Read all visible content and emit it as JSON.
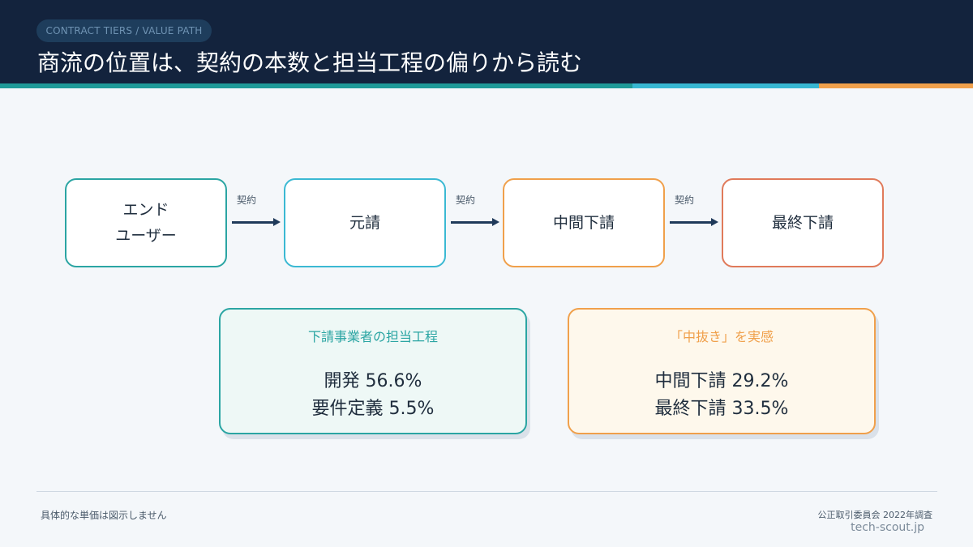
{
  "header": {
    "tag": "CONTRACT TIERS / VALUE PATH",
    "title": "商流の位置は、契約の本数と担当工程の偏りから読む"
  },
  "flow": {
    "nodes": [
      {
        "line1": "エンド",
        "line2": "ユーザー"
      },
      {
        "line1": "元請",
        "line2": ""
      },
      {
        "line1": "中間下請",
        "line2": ""
      },
      {
        "line1": "最終下請",
        "line2": ""
      }
    ],
    "edges": [
      {
        "label": "契約"
      },
      {
        "label": "契約"
      },
      {
        "label": "契約"
      }
    ]
  },
  "cards": [
    {
      "title": "下請事業者の担当工程",
      "line1": "開発 56.6%",
      "line2": "要件定義 5.5%"
    },
    {
      "title": "「中抜き」を実感",
      "line1": "中間下請 29.2%",
      "line2": "最終下請 33.5%"
    }
  ],
  "footer": {
    "note": "具体的な単価は図示しません",
    "source": "公正取引委員会 2022年調査",
    "brand": "tech-scout.jp"
  },
  "colors": {
    "header_bg": "#13233d",
    "teal": "#2ba5a3",
    "cyan": "#3bb9d3",
    "orange": "#f0a04b",
    "coral": "#e07a5a",
    "arrow": "#1f3a5a"
  }
}
